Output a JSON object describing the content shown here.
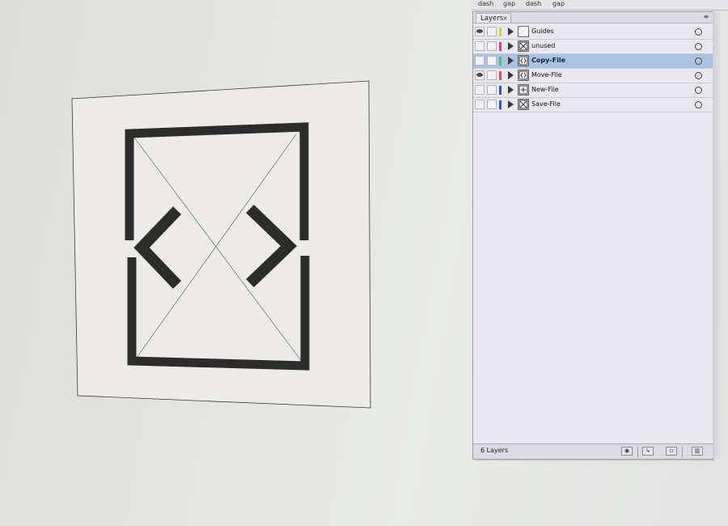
{
  "stroke_panel": {
    "labels": [
      "dash",
      "gap",
      "dash",
      "gap"
    ]
  },
  "layers_panel": {
    "tab_label": "Layers",
    "close_glyph": "×",
    "menu_glyph": "≡",
    "layer_count": "6 Layers",
    "layers": [
      {
        "name": "Guides",
        "visible": true,
        "color": "#c8d850",
        "selected": false
      },
      {
        "name": "unused",
        "visible": false,
        "color": "#d2468a",
        "selected": false
      },
      {
        "name": "Copy-File",
        "visible": false,
        "color": "#5fb67a",
        "selected": true
      },
      {
        "name": "Move-File",
        "visible": true,
        "color": "#d85252",
        "selected": false
      },
      {
        "name": "New-File",
        "visible": false,
        "color": "#3b4fc8",
        "selected": false
      },
      {
        "name": "Save-File",
        "visible": false,
        "color": "#3b4fc8",
        "selected": false
      }
    ],
    "footer_icons": [
      "locate-object-icon",
      "make-clipping-mask-icon",
      "new-sublayer-icon",
      "new-layer-icon",
      "delete-layer-icon"
    ]
  },
  "artwork": {
    "icon": "move-file-glyph",
    "stroke_color": "#2d2c2c"
  }
}
